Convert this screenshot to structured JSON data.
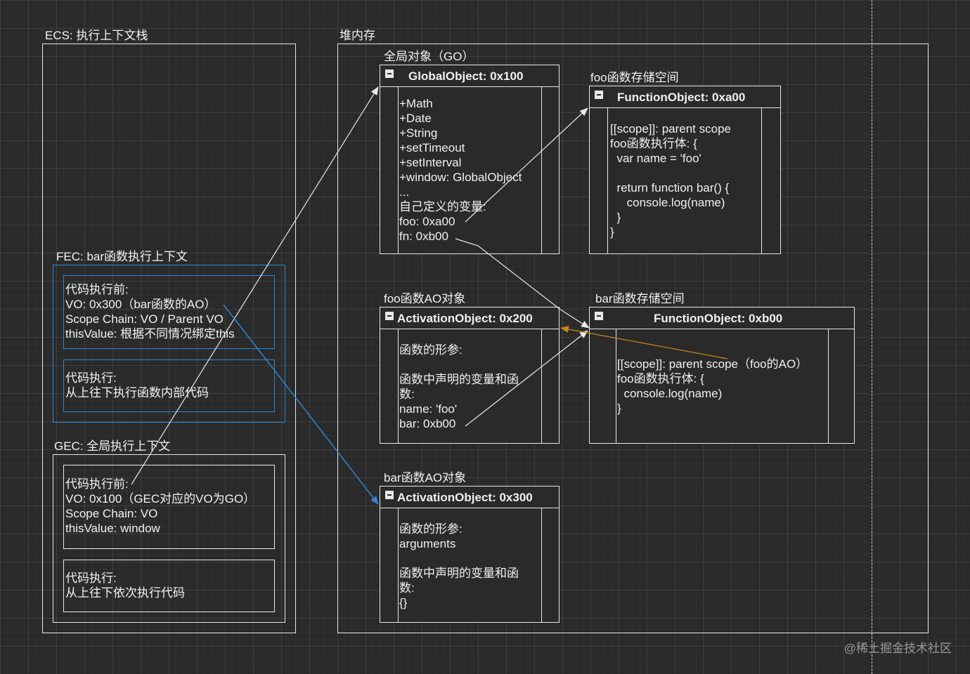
{
  "ecs": {
    "label": "ECS: 执行上下文栈",
    "fec": {
      "label": "FEC: bar函数执行上下文",
      "before": [
        "代码执行前:",
        "VO: 0x300（bar函数的AO）",
        "Scope Chain: VO / Parent VO",
        "thisValue: 根据不同情况绑定this"
      ],
      "exec": [
        "代码执行:",
        "从上往下执行函数内部代码"
      ]
    },
    "gec": {
      "label": "GEC: 全局执行上下文",
      "before": [
        "代码执行前:",
        "VO: 0x100（GEC对应的VO为GO）",
        "Scope Chain: VO",
        "thisValue: window"
      ],
      "exec": [
        "代码执行:",
        "从上往下依次执行代码"
      ]
    }
  },
  "heap": {
    "label": "堆内存",
    "go": {
      "label": "全局对象（GO）",
      "title": "GlobalObject: 0x100",
      "lines": [
        "+Math",
        "+Date",
        "+String",
        "+setTimeout",
        "+setInterval",
        "+window: GlobalObject",
        "...",
        "自己定义的变量:",
        "foo: 0xa00",
        "fn: 0xb00"
      ]
    },
    "foo_func": {
      "label": "foo函数存储空间",
      "title": "FunctionObject: 0xa00",
      "lines": [
        "[[scope]]: parent scope",
        "foo函数执行体: {",
        "  var name = 'foo'",
        "",
        "  return function bar() {",
        "     console.log(name)",
        "  }",
        "}"
      ]
    },
    "foo_ao": {
      "label": "foo函数AO对象",
      "title": "ActivationObject: 0x200",
      "lines": [
        "函数的形参:",
        "",
        "函数中声明的变量和函",
        "数:",
        "name: 'foo'",
        "bar: 0xb00"
      ]
    },
    "bar_func": {
      "label": "bar函数存储空间",
      "title": "FunctionObject: 0xb00",
      "lines": [
        "[[scope]]: parent scope（foo的AO）",
        "foo函数执行体: {",
        "  console.log(name)",
        "}"
      ]
    },
    "bar_ao": {
      "label": "bar函数AO对象",
      "title": "ActivationObject: 0x300",
      "lines": [
        "函数的形参:",
        "arguments",
        "",
        "函数中声明的变量和函",
        "数:",
        "{}"
      ]
    }
  },
  "watermark": "@稀土掘金技术社区",
  "colors": {
    "background": "#2a2a2a",
    "line": "#e8e8e8",
    "blue": "#2f86d6",
    "orange": "#c8871a"
  }
}
